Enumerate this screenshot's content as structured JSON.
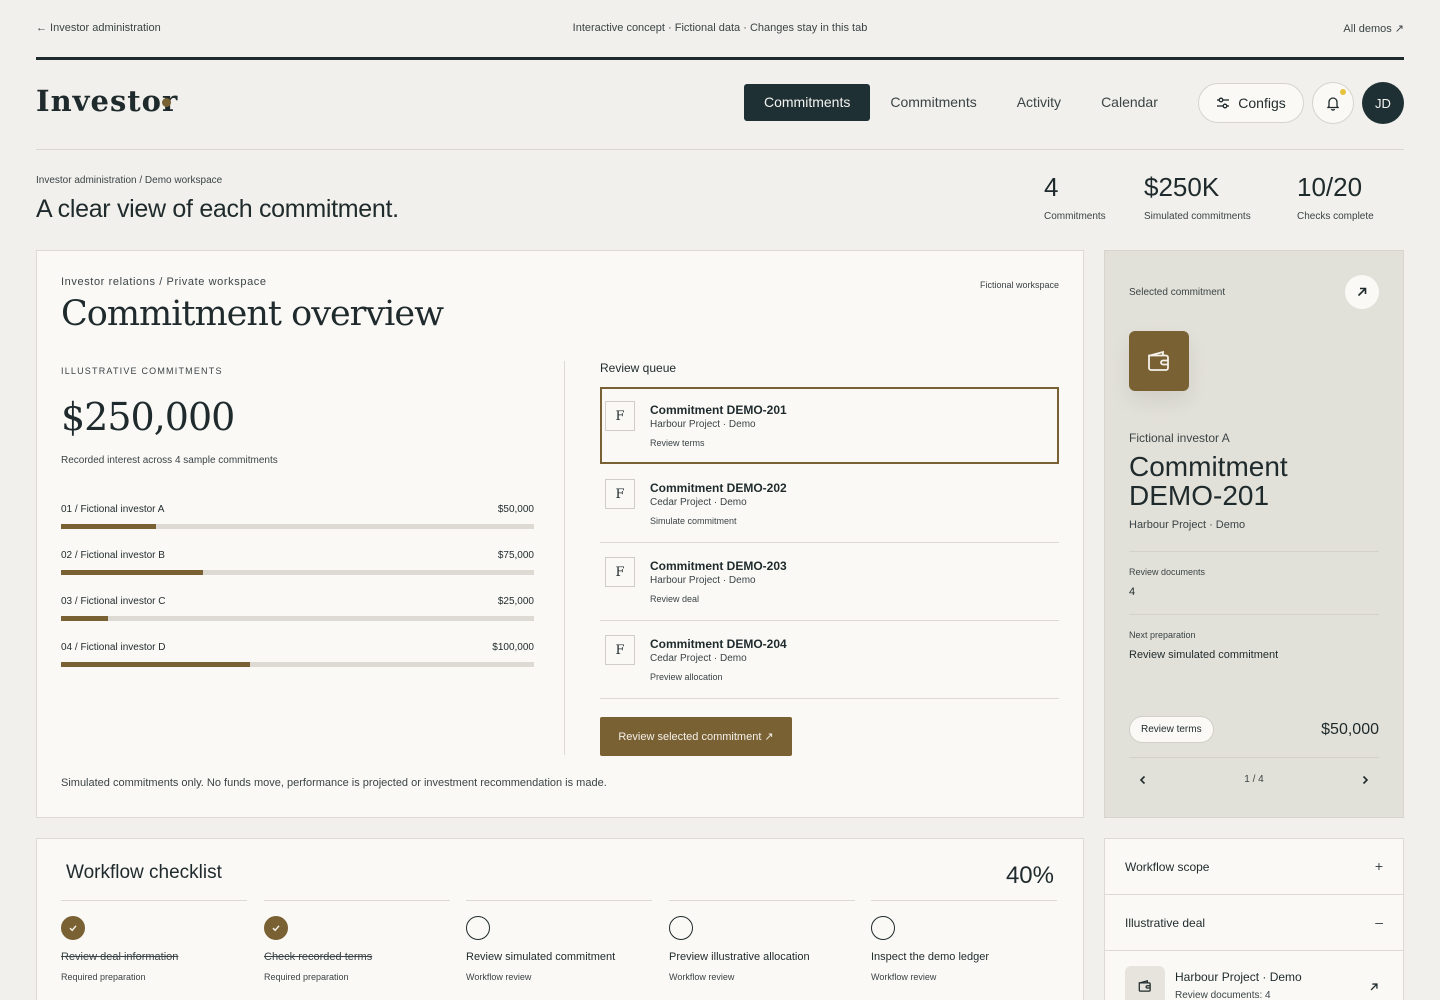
{
  "topbar": {
    "back_link": "← Investor administration",
    "notice": "Interactive concept · Fictional data · Changes stay in this tab",
    "all_demos": "All demos ↗"
  },
  "brand": {
    "logo": "Investor"
  },
  "nav": {
    "tabs": [
      {
        "label": "Commitments",
        "active": true
      },
      {
        "label": "Commitments",
        "active": false
      },
      {
        "label": "Activity",
        "active": false
      },
      {
        "label": "Calendar",
        "active": false
      }
    ],
    "configs_label": "Configs",
    "avatar_initials": "JD"
  },
  "page": {
    "breadcrumb": "Investor administration / Demo workspace",
    "headline": "A clear view of each commitment.",
    "stats": [
      {
        "value": "4",
        "label": "Commitments"
      },
      {
        "value": "$250K",
        "label": "Simulated commitments"
      },
      {
        "value": "10/20",
        "label": "Checks complete"
      }
    ]
  },
  "overview": {
    "eyebrow": "Investor relations / Private workspace",
    "tag": "Fictional workspace",
    "title": "Commitment overview",
    "section_label": "ILLUSTRATIVE COMMITMENTS",
    "total": "$250,000",
    "total_caption": "Recorded interest across 4 sample commitments",
    "investors": [
      {
        "label": "01 / Fictional investor A",
        "amount": "$50,000",
        "share": 0.2
      },
      {
        "label": "02 / Fictional investor B",
        "amount": "$75,000",
        "share": 0.3
      },
      {
        "label": "03 / Fictional investor C",
        "amount": "$25,000",
        "share": 0.1
      },
      {
        "label": "04 / Fictional investor D",
        "amount": "$100,000",
        "share": 0.4
      }
    ],
    "disclaimer": "Simulated commitments only. No funds move, performance is projected or investment recommendation is made."
  },
  "queue": {
    "title": "Review queue",
    "items": [
      {
        "badge": "F",
        "title": "Commitment DEMO-201",
        "subtitle": "Harbour Project · Demo",
        "action": "Review terms",
        "selected": true
      },
      {
        "badge": "F",
        "title": "Commitment DEMO-202",
        "subtitle": "Cedar Project · Demo",
        "action": "Simulate commitment",
        "selected": false
      },
      {
        "badge": "F",
        "title": "Commitment DEMO-203",
        "subtitle": "Harbour Project · Demo",
        "action": "Review deal",
        "selected": false
      },
      {
        "badge": "F",
        "title": "Commitment DEMO-204",
        "subtitle": "Cedar Project · Demo",
        "action": "Preview allocation",
        "selected": false
      }
    ],
    "button_label": "Review selected commitment ↗"
  },
  "selected": {
    "label": "Selected commitment",
    "investor": "Fictional investor A",
    "title_line1": "Commitment",
    "title_line2": "DEMO-201",
    "project": "Harbour Project · Demo",
    "docs_label": "Review documents",
    "docs_value": "4",
    "next_label": "Next preparation",
    "next_value": "Review simulated commitment",
    "pill": "Review terms",
    "amount": "$50,000",
    "pager": "1 / 4"
  },
  "workflow": {
    "title": "Workflow checklist",
    "percent": "40%",
    "steps": [
      {
        "label": "Review deal information",
        "sub": "Required preparation",
        "done": true
      },
      {
        "label": "Check recorded terms",
        "sub": "Required preparation",
        "done": true
      },
      {
        "label": "Review simulated commitment",
        "sub": "Workflow review",
        "done": false
      },
      {
        "label": "Preview illustrative allocation",
        "sub": "Workflow review",
        "done": false
      },
      {
        "label": "Inspect the demo ledger",
        "sub": "Workflow review",
        "done": false
      }
    ]
  },
  "accordion": {
    "scope_label": "Workflow scope",
    "scope_symbol": "+",
    "deal_label": "Illustrative deal",
    "deal_symbol": "–",
    "deal_item_title": "Harbour Project · Demo",
    "deal_item_sub": "Review documents: 4"
  },
  "colors": {
    "accent": "#7a6134",
    "dark": "#1f3034",
    "background": "#f1f0ec",
    "panel": "#e2e1d9"
  }
}
